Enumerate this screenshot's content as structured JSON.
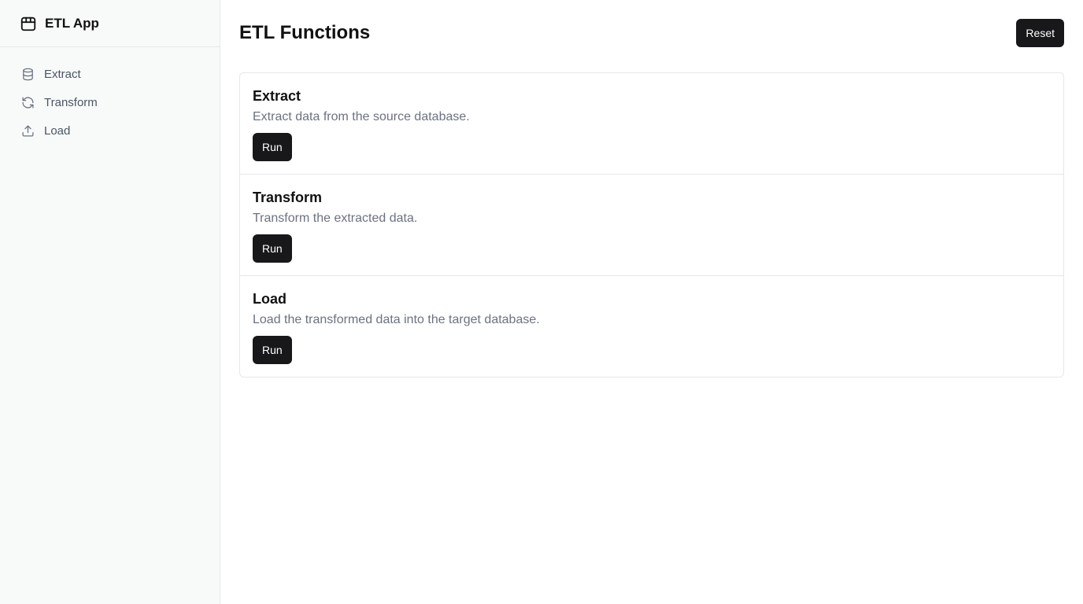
{
  "app": {
    "title": "ETL App",
    "brand_icon": "package-icon"
  },
  "sidebar": {
    "items": [
      {
        "label": "Extract",
        "icon": "database-icon"
      },
      {
        "label": "Transform",
        "icon": "refresh-icon"
      },
      {
        "label": "Load",
        "icon": "upload-icon"
      }
    ]
  },
  "header": {
    "title": "ETL Functions",
    "reset_label": "Reset"
  },
  "functions": [
    {
      "title": "Extract",
      "description": "Extract data from the source database.",
      "run_label": "Run"
    },
    {
      "title": "Transform",
      "description": "Transform the extracted data.",
      "run_label": "Run"
    },
    {
      "title": "Load",
      "description": "Load the transformed data into the target database.",
      "run_label": "Run"
    }
  ],
  "colors": {
    "sidebar_bg": "#f8fafa",
    "button_bg": "#18181b",
    "muted_text": "#6b7280"
  }
}
